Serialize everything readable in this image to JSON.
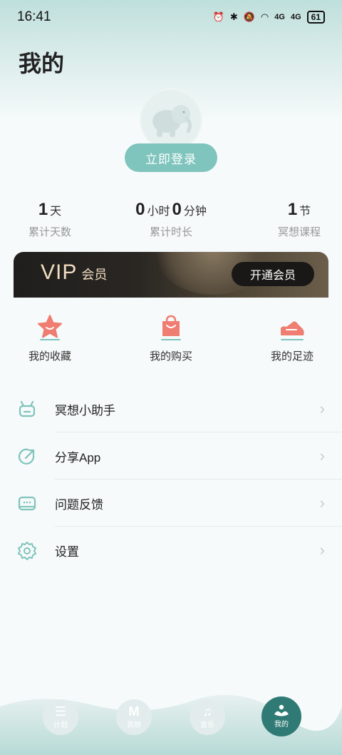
{
  "status_bar": {
    "time": "16:41",
    "battery": "61",
    "signal1": "4G",
    "signal2": "4G"
  },
  "page": {
    "title": "我的"
  },
  "profile": {
    "login_label": "立即登录"
  },
  "stats": [
    {
      "parts": [
        {
          "num": "1",
          "unit": "天"
        }
      ],
      "label": "累计天数"
    },
    {
      "parts": [
        {
          "num": "0",
          "unit": "小时"
        },
        {
          "num": "0",
          "unit": "分钟"
        }
      ],
      "label": "累计时长"
    },
    {
      "parts": [
        {
          "num": "1",
          "unit": "节"
        }
      ],
      "label": "冥想课程"
    }
  ],
  "vip": {
    "title": "VIP",
    "subtitle": "会员",
    "button": "开通会员"
  },
  "quick_actions": [
    {
      "label": "我的收藏",
      "icon": "star-icon"
    },
    {
      "label": "我的购买",
      "icon": "shopping-bag-icon"
    },
    {
      "label": "我的足迹",
      "icon": "shoe-icon"
    }
  ],
  "menu": [
    {
      "label": "冥想小助手",
      "icon": "robot-icon"
    },
    {
      "label": "分享App",
      "icon": "share-icon"
    },
    {
      "label": "问题反馈",
      "icon": "feedback-icon"
    },
    {
      "label": "设置",
      "icon": "settings-icon"
    }
  ],
  "nav": [
    {
      "label": "计划",
      "icon": "list-icon",
      "glyph": "☰"
    },
    {
      "label": "冥想",
      "icon": "meditation-m-icon",
      "glyph": "M"
    },
    {
      "label": "音乐",
      "icon": "music-icon",
      "glyph": "♫"
    },
    {
      "label": "我的",
      "icon": "profile-lotus-icon",
      "glyph": ""
    }
  ],
  "colors": {
    "accent": "#7fc4bd",
    "nav_active": "#2f7a74",
    "coral": "#ef7d72",
    "vip_gold": "#f1dcc0"
  }
}
